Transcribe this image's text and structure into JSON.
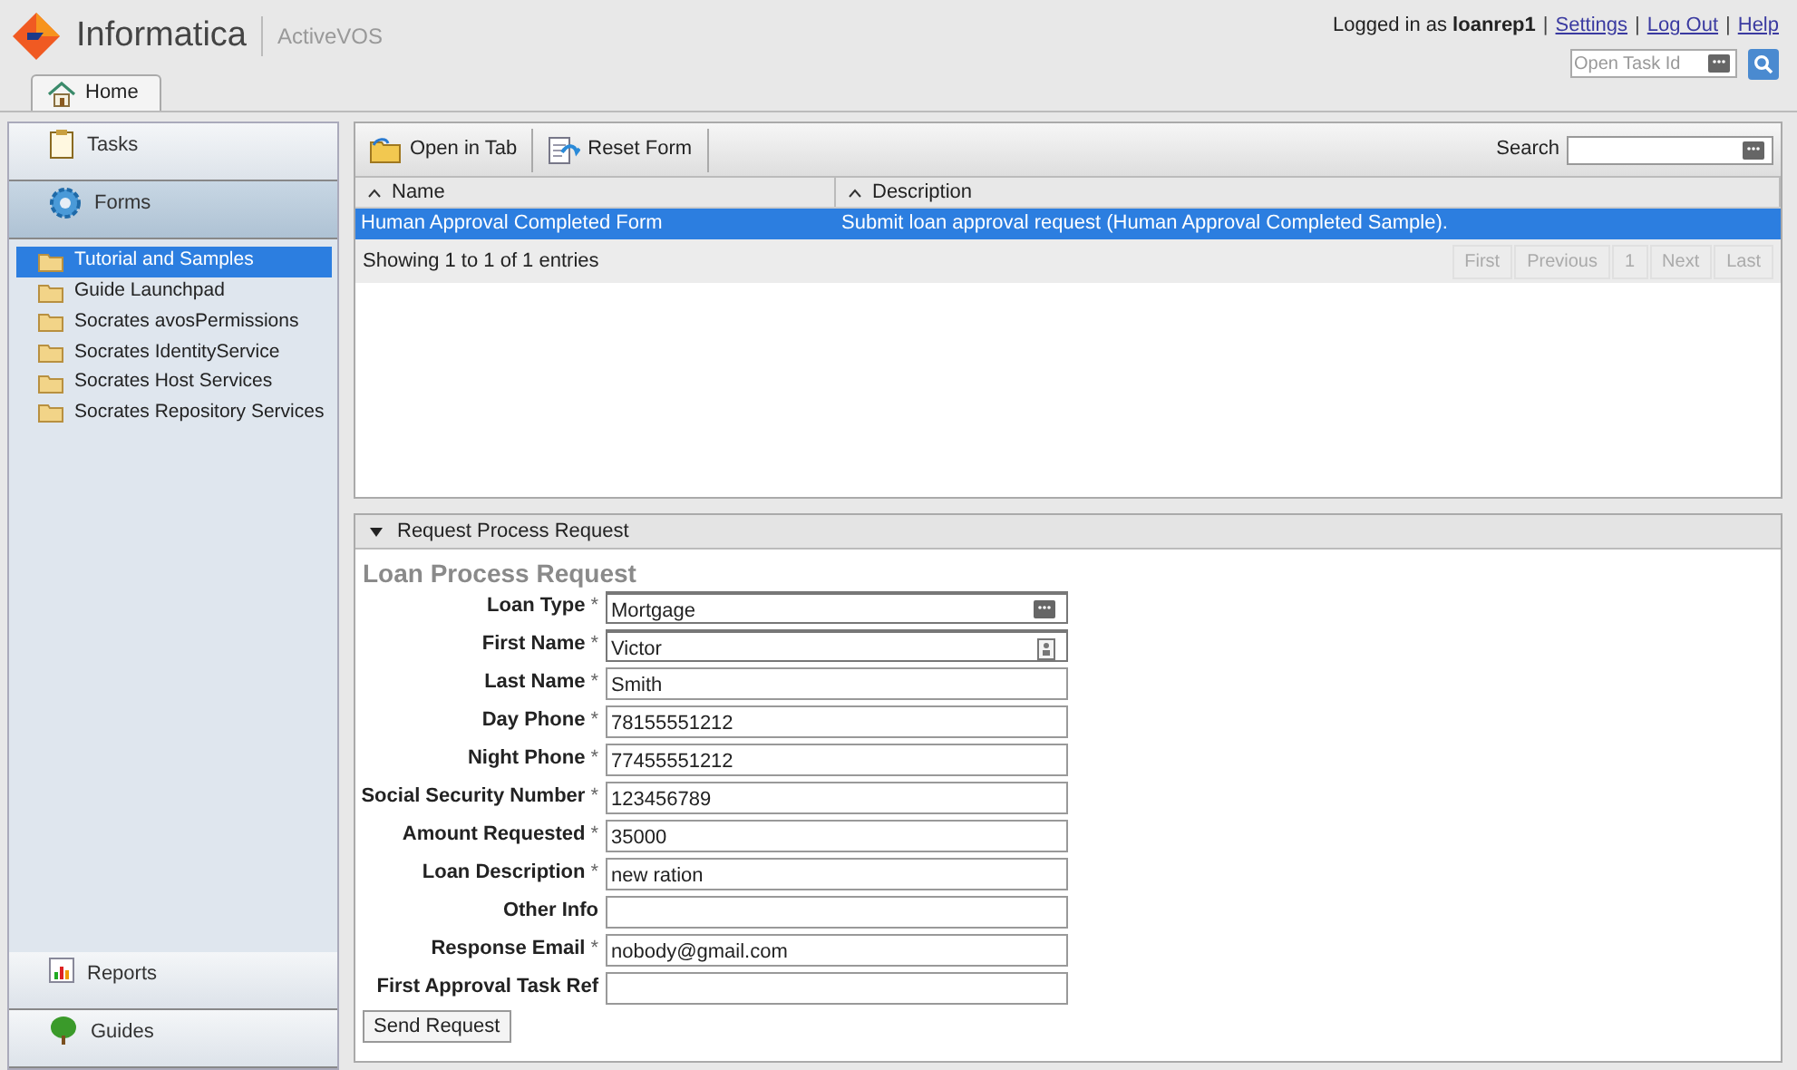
{
  "header": {
    "brand": "Informatica",
    "product": "ActiveVOS",
    "logged_in_prefix": "Logged in as ",
    "user": "loanrep1",
    "separator": "|",
    "links": [
      "Settings",
      "Log Out",
      "Help"
    ],
    "task_id": {
      "placeholder": "Open Task Id"
    }
  },
  "tabs": [
    {
      "label": "Home",
      "selected": true
    }
  ],
  "sidebar": {
    "top_sections": [
      {
        "label": "Tasks",
        "kind": "tasks",
        "selected": false
      },
      {
        "label": "Forms",
        "kind": "forms",
        "selected": true
      }
    ],
    "tree": [
      {
        "label": "Tutorial and Samples",
        "selected": true
      },
      {
        "label": "Guide Launchpad",
        "selected": false
      },
      {
        "label": "Socrates avosPermissions",
        "selected": false
      },
      {
        "label": "Socrates IdentityService",
        "selected": false
      },
      {
        "label": "Socrates Host Services",
        "selected": false
      },
      {
        "label": "Socrates Repository Services",
        "selected": false
      }
    ],
    "bottom_sections": [
      {
        "label": "Reports",
        "kind": "reports",
        "selected": false
      },
      {
        "label": "Guides",
        "kind": "guides",
        "selected": false
      }
    ]
  },
  "toolbar": {
    "buttons": [
      {
        "label": "Open in Tab",
        "kind": "open"
      },
      {
        "label": "Reset Form",
        "kind": "reset"
      }
    ],
    "search_label": "Search"
  },
  "table": {
    "columns": [
      "Name",
      "Description"
    ],
    "rows": [
      {
        "cells": [
          "Human Approval Completed Form",
          "Submit loan approval request (Human Approval Completed Sample)."
        ],
        "selected": true
      }
    ],
    "info": "Showing 1 to 1 of 1 entries",
    "pager": [
      {
        "label": "First",
        "disabled": true
      },
      {
        "label": "Previous",
        "disabled": true
      },
      {
        "label": "1",
        "disabled": true
      },
      {
        "label": "Next",
        "disabled": true
      },
      {
        "label": "Last",
        "disabled": true
      }
    ]
  },
  "form_panel": {
    "header": "Request Process Request",
    "expanded": true,
    "title": "Loan Process Request",
    "fields": [
      {
        "label": "Loan Type",
        "required_mark": "*",
        "value": "Mortgage",
        "kind": "picker"
      },
      {
        "label": "First Name",
        "required_mark": "*",
        "value": "Victor",
        "kind": "contact"
      },
      {
        "label": "Last Name",
        "required_mark": "*",
        "value": "Smith",
        "kind": "text"
      },
      {
        "label": "Day Phone",
        "required_mark": "*",
        "value": "78155551212",
        "kind": "text"
      },
      {
        "label": "Night Phone",
        "required_mark": "*",
        "value": "77455551212",
        "kind": "text"
      },
      {
        "label": "Social Security Number",
        "required_mark": "*",
        "value": "123456789",
        "kind": "text"
      },
      {
        "label": "Amount Requested",
        "required_mark": "*",
        "value": "35000",
        "kind": "text"
      },
      {
        "label": "Loan Description",
        "required_mark": "*",
        "value": "new ration",
        "kind": "text"
      },
      {
        "label": "Other Info",
        "kind": "text"
      },
      {
        "label": "Response Email",
        "required_mark": "*",
        "value": "nobody@gmail.com",
        "kind": "text"
      },
      {
        "label": "First Approval Task Ref",
        "kind": "text"
      }
    ],
    "submit": "Send Request"
  }
}
